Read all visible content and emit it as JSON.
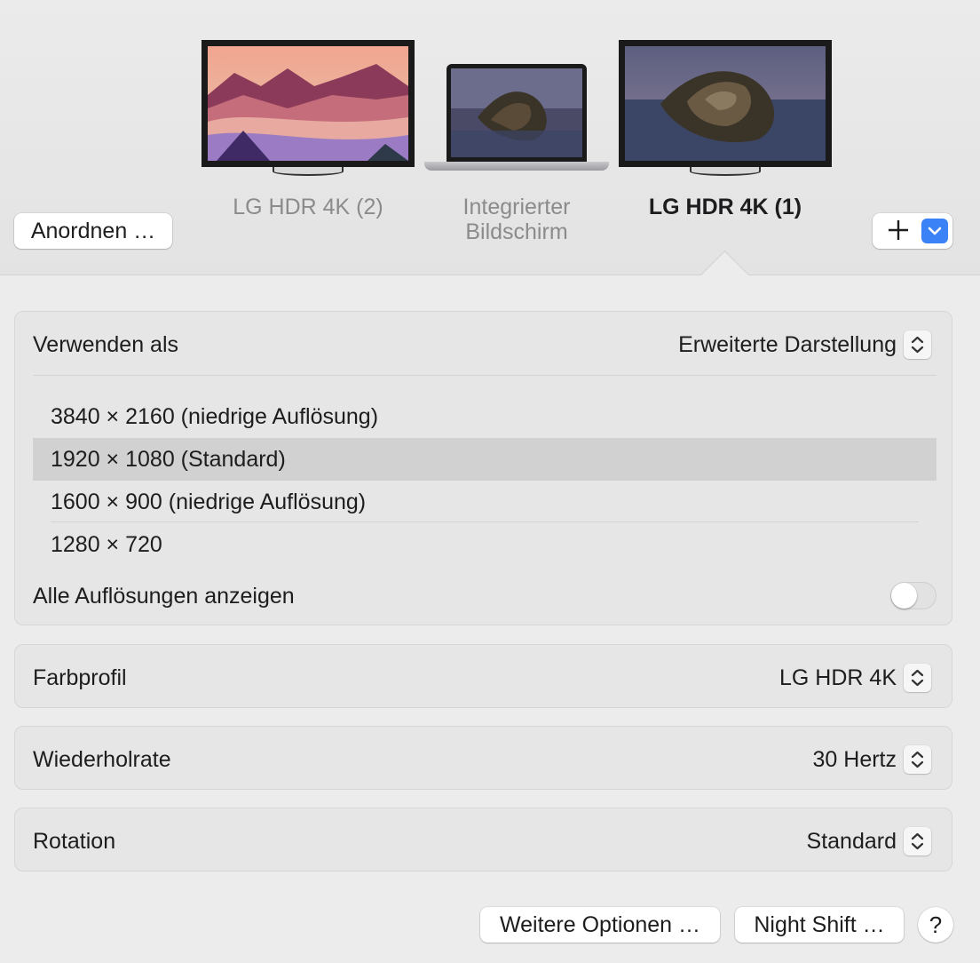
{
  "toolbar": {
    "arrange_label": "Anordnen …",
    "add_icon": "plus-icon",
    "dropdown_icon": "chevron-down-icon"
  },
  "displays": [
    {
      "label": "LG HDR 4K (2)",
      "active": false
    },
    {
      "label_line1": "Integrierter",
      "label_line2": "Bildschirm",
      "active": false
    },
    {
      "label": "LG HDR 4K (1)",
      "active": true
    }
  ],
  "use_as": {
    "label": "Verwenden als",
    "value": "Erweiterte Darstellung"
  },
  "resolutions": {
    "items": [
      "3840 × 2160 (niedrige Auflösung)",
      "1920 × 1080 (Standard)",
      "1600 × 900 (niedrige Auflösung)",
      "1280 × 720"
    ],
    "selected": "1920 × 1080 (Standard)",
    "show_all_label": "Alle Auflösungen anzeigen",
    "show_all_enabled": false
  },
  "color_profile": {
    "label": "Farbprofil",
    "value": "LG HDR 4K"
  },
  "refresh_rate": {
    "label": "Wiederholrate",
    "value": "30 Hertz"
  },
  "rotation": {
    "label": "Rotation",
    "value": "Standard"
  },
  "footer": {
    "more_options": "Weitere Optionen …",
    "night_shift": "Night Shift …",
    "help": "?"
  },
  "colors": {
    "accent": "#3b82f6"
  }
}
